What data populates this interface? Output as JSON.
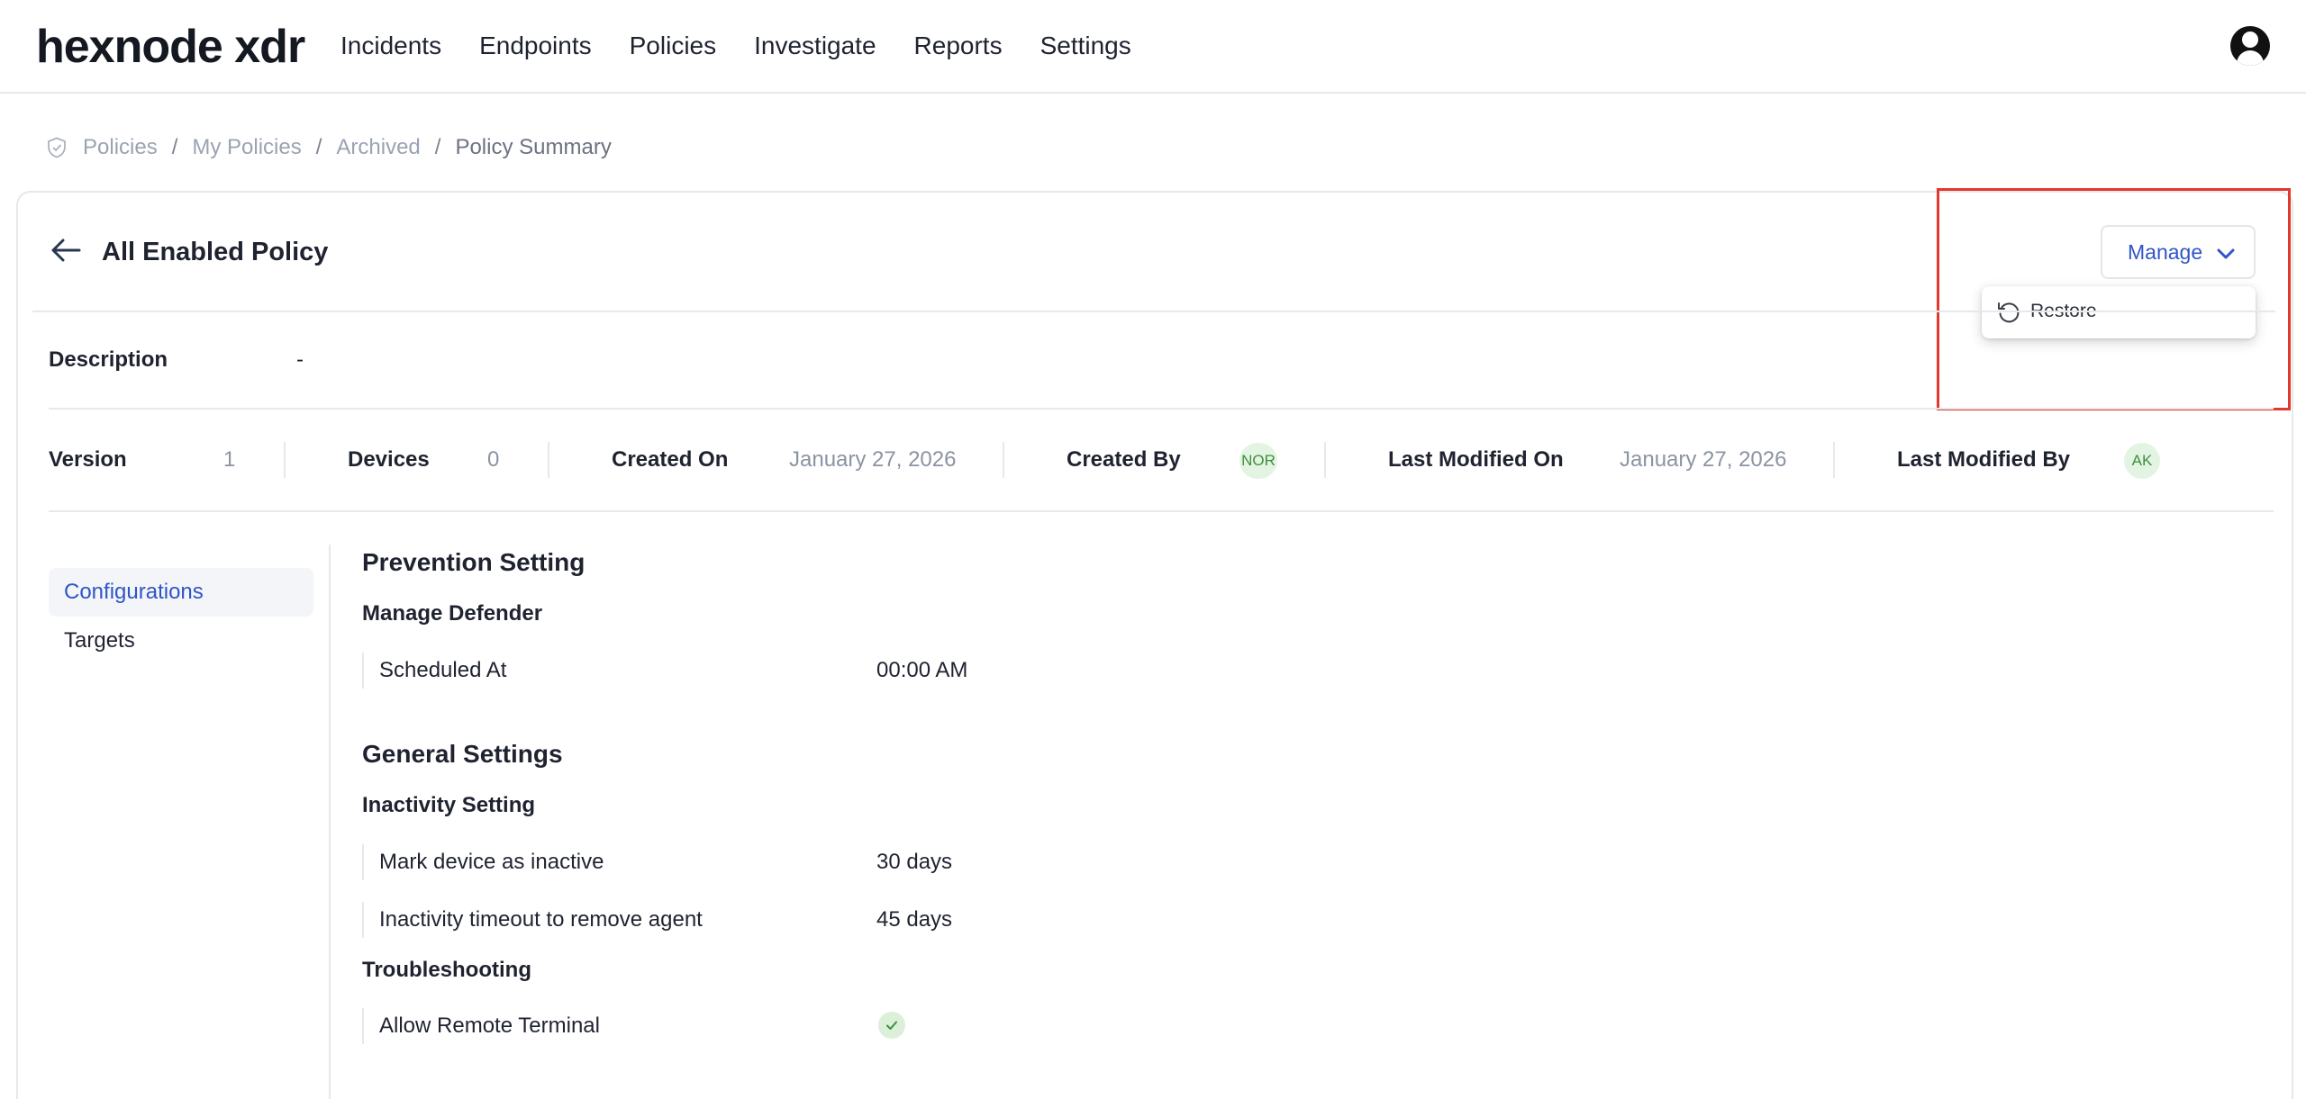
{
  "header": {
    "logo": "hexnode xdr",
    "nav": [
      "Incidents",
      "Endpoints",
      "Policies",
      "Investigate",
      "Reports",
      "Settings"
    ]
  },
  "breadcrumb": {
    "items": [
      "Policies",
      "My Policies",
      "Archived"
    ],
    "current": "Policy Summary",
    "separator": "/"
  },
  "policy": {
    "title": "All Enabled Policy",
    "manage_label": "Manage",
    "menu": {
      "restore_label": "Restore"
    },
    "description_label": "Description",
    "description_value": "-"
  },
  "meta": {
    "version_label": "Version",
    "version_value": "1",
    "devices_label": "Devices",
    "devices_value": "0",
    "created_on_label": "Created On",
    "created_on_value": "January 27, 2026",
    "created_by_label": "Created By",
    "created_by_value": "NOR",
    "last_modified_on_label": "Last Modified On",
    "last_modified_on_value": "January 27, 2026",
    "last_modified_by_label": "Last Modified By",
    "last_modified_by_value": "AK"
  },
  "tabs": [
    "Configurations",
    "Targets"
  ],
  "active_tab": "Configurations",
  "sections": {
    "prevention": {
      "title": "Prevention Setting",
      "group": "Manage Defender",
      "rows": [
        {
          "label": "Scheduled At",
          "value": "00:00 AM"
        }
      ]
    },
    "general": {
      "title": "General Settings",
      "group1": "Inactivity Setting",
      "rows1": [
        {
          "label": "Mark device as inactive",
          "value": "30 days"
        },
        {
          "label": "Inactivity timeout to remove agent",
          "value": "45 days"
        }
      ],
      "group2": "Troubleshooting",
      "rows2": [
        {
          "label": "Allow Remote Terminal",
          "value_icon": "check-icon"
        }
      ]
    }
  },
  "colors": {
    "accent": "#2f55c8",
    "highlight": "#e0392d",
    "badge_bg": "#e4f4e2",
    "badge_text": "#3f8f3f"
  }
}
